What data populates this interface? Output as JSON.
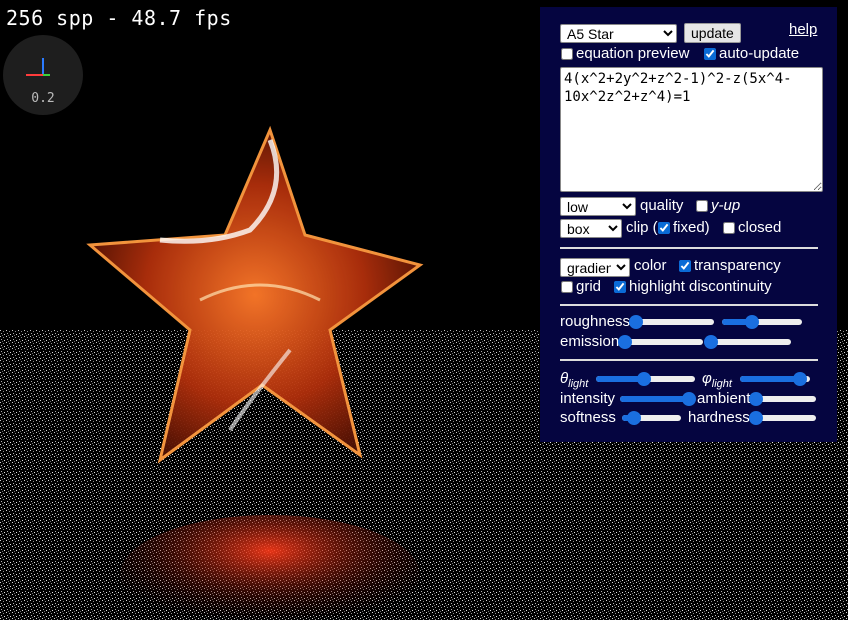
{
  "status": {
    "fps_text": "256 spp - 48.7 fps"
  },
  "axes_widget": {
    "scale_label": "0.2"
  },
  "panel": {
    "preset_select": {
      "selected": "A5 Star"
    },
    "update_button": "update",
    "help_link": "help",
    "equation_preview_label": "equation preview",
    "equation_preview_checked": false,
    "auto_update_label": "auto-update",
    "auto_update_checked": true,
    "equation_text": "4(x^2+2y^2+z^2-1)^2-z(5x^4-10x^2z^2+z^4)=1",
    "quality_select": {
      "selected": "low"
    },
    "quality_label": "quality",
    "y_up_label": "y-up",
    "y_up_checked": false,
    "clip_select": {
      "selected": "box"
    },
    "clip_label": "clip (",
    "fixed_label": "fixed)",
    "fixed_checked": true,
    "closed_label": "closed",
    "closed_checked": false,
    "color_select": {
      "selected": "gradient"
    },
    "color_label": "color",
    "transparency_label": "transparency",
    "transparency_checked": true,
    "grid_label": "grid",
    "grid_checked": false,
    "highlight_label": "highlight discontinuity",
    "highlight_checked": true,
    "roughness_label": "roughness",
    "roughness_values": [
      0.0,
      0.38
    ],
    "emission_label": "emission",
    "emission_values": [
      0.0,
      0.0
    ],
    "theta_symbol": "θ",
    "theta_sub": "light",
    "theta_value": 0.48,
    "phi_symbol": "φ",
    "phi_sub": "light",
    "phi_value": 0.85,
    "intensity_label": "intensity",
    "intensity_value": 0.98,
    "ambient_label": "ambient",
    "ambient_value": 0.0,
    "softness_label": "softness",
    "softness_value": 0.2,
    "hardness_label": "hardness",
    "hardness_value": 0.0
  },
  "colors": {
    "panel_bg": "#050540",
    "accent": "#1a6fe0"
  }
}
